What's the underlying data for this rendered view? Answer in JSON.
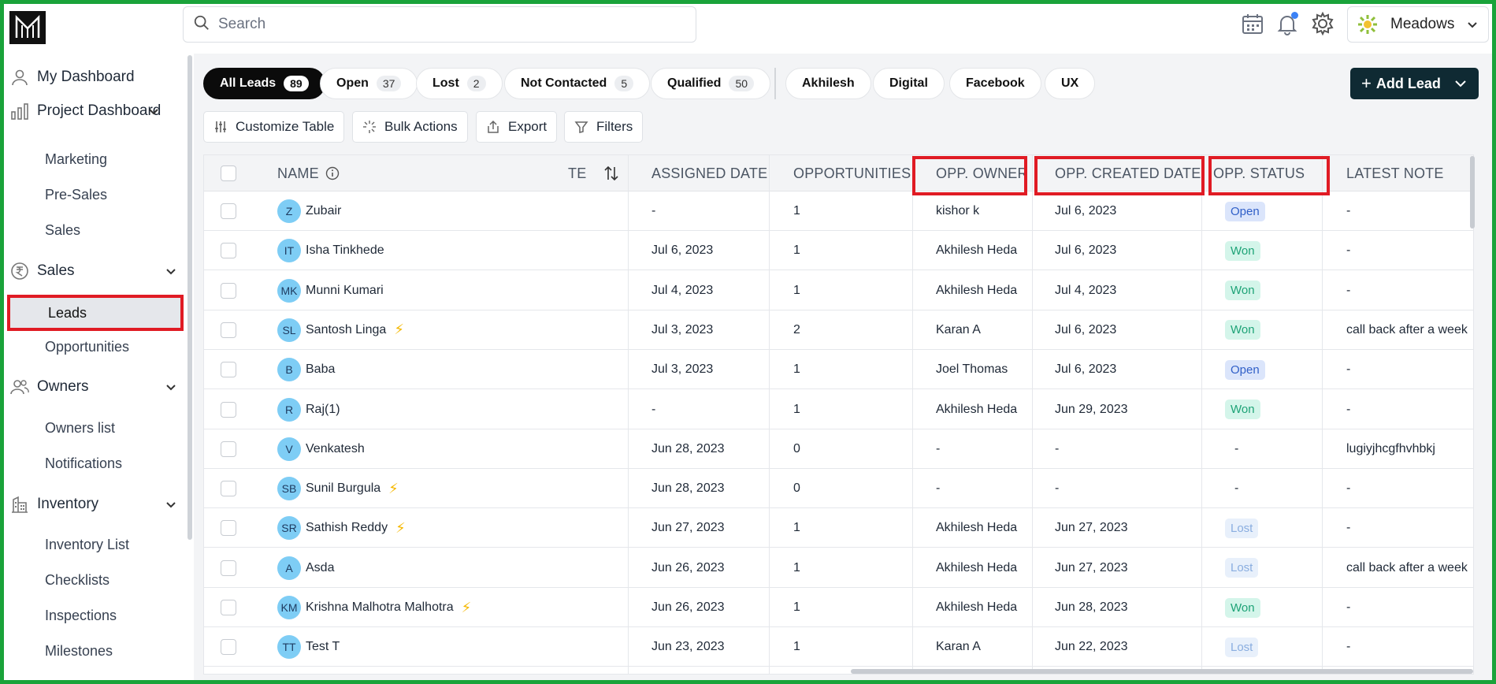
{
  "search": {
    "placeholder": "Search"
  },
  "user": {
    "name": "Meadows"
  },
  "sidebar": {
    "my_dashboard": "My Dashboard",
    "project_dashboard": "Project Dashboard",
    "project_sub": [
      "Marketing",
      "Pre-Sales",
      "Sales"
    ],
    "sales": "Sales",
    "sales_sub": [
      "Leads",
      "Opportunities"
    ],
    "owners": "Owners",
    "owners_sub": [
      "Owners list",
      "Notifications"
    ],
    "inventory": "Inventory",
    "inventory_sub": [
      "Inventory List",
      "Checklists",
      "Inspections",
      "Milestones"
    ]
  },
  "filters": [
    {
      "label": "All Leads",
      "count": "89"
    },
    {
      "label": "Open",
      "count": "37"
    },
    {
      "label": "Lost",
      "count": "2"
    },
    {
      "label": "Not Contacted",
      "count": "5"
    },
    {
      "label": "Qualified",
      "count": "50"
    }
  ],
  "tags": [
    "Akhilesh",
    "Digital",
    "Facebook",
    "UX"
  ],
  "add_lead": "Add Lead",
  "toolbar": {
    "customize": "Customize Table",
    "bulk": "Bulk Actions",
    "export": "Export",
    "filters": "Filters"
  },
  "table": {
    "headers": {
      "name": "NAME",
      "te": "TE",
      "assigned": "ASSIGNED DATE",
      "opportunities": "OPPORTUNITIES",
      "owner": "OPP. OWNER",
      "created": "OPP. CREATED DATE",
      "status": "OPP. STATUS",
      "note": "LATEST NOTE"
    },
    "rows": [
      {
        "initials": "Z",
        "name": "Zubair",
        "bolt": false,
        "assigned": "-",
        "opps": "1",
        "owner": "kishor k",
        "created": "Jul 6, 2023",
        "status": "Open",
        "note": "-"
      },
      {
        "initials": "IT",
        "name": "Isha Tinkhede",
        "bolt": false,
        "assigned": "Jul 6, 2023",
        "opps": "1",
        "owner": "Akhilesh Heda",
        "created": "Jul 6, 2023",
        "status": "Won",
        "note": "-"
      },
      {
        "initials": "MK",
        "name": "Munni Kumari",
        "bolt": false,
        "assigned": "Jul 4, 2023",
        "opps": "1",
        "owner": "Akhilesh Heda",
        "created": "Jul 4, 2023",
        "status": "Won",
        "note": "-"
      },
      {
        "initials": "SL",
        "name": "Santosh Linga",
        "bolt": true,
        "assigned": "Jul 3, 2023",
        "opps": "2",
        "owner": "Karan A",
        "created": "Jul 6, 2023",
        "status": "Won",
        "note": "call back after a week"
      },
      {
        "initials": "B",
        "name": "Baba",
        "bolt": false,
        "assigned": "Jul 3, 2023",
        "opps": "1",
        "owner": "Joel Thomas",
        "created": "Jul 6, 2023",
        "status": "Open",
        "note": "-"
      },
      {
        "initials": "R",
        "name": "Raj(1)",
        "bolt": false,
        "assigned": "-",
        "opps": "1",
        "owner": "Akhilesh Heda",
        "created": "Jun 29, 2023",
        "status": "Won",
        "note": "-"
      },
      {
        "initials": "V",
        "name": "Venkatesh",
        "bolt": false,
        "assigned": "Jun 28, 2023",
        "opps": "0",
        "owner": "-",
        "created": "-",
        "status": "-",
        "note": "lugiyjhcgfhvhbkj"
      },
      {
        "initials": "SB",
        "name": "Sunil Burgula",
        "bolt": true,
        "assigned": "Jun 28, 2023",
        "opps": "0",
        "owner": "-",
        "created": "-",
        "status": "-",
        "note": "-"
      },
      {
        "initials": "SR",
        "name": "Sathish Reddy",
        "bolt": true,
        "assigned": "Jun 27, 2023",
        "opps": "1",
        "owner": "Akhilesh Heda",
        "created": "Jun 27, 2023",
        "status": "Lost",
        "note": "-"
      },
      {
        "initials": "A",
        "name": "Asda",
        "bolt": false,
        "assigned": "Jun 26, 2023",
        "opps": "1",
        "owner": "Akhilesh Heda",
        "created": "Jun 27, 2023",
        "status": "Lost",
        "note": "call back after a week"
      },
      {
        "initials": "KM",
        "name": "Krishna Malhotra Malhotra",
        "bolt": true,
        "assigned": "Jun 26, 2023",
        "opps": "1",
        "owner": "Akhilesh Heda",
        "created": "Jun 28, 2023",
        "status": "Won",
        "note": "-"
      },
      {
        "initials": "TT",
        "name": "Test T",
        "bolt": false,
        "assigned": "Jun 23, 2023",
        "opps": "1",
        "owner": "Karan A",
        "created": "Jun 22, 2023",
        "status": "Lost",
        "note": "-"
      }
    ]
  },
  "colors": {
    "accent": "#0f2a33",
    "highlight": "#e01b24",
    "frame": "#1aa33a",
    "avatar": "#7ecdf5"
  },
  "icons": [
    "logo-icon",
    "search-icon",
    "calendar-icon",
    "bell-icon",
    "gear-icon",
    "chevron-down-icon",
    "user-icon",
    "chart-icon",
    "rupee-icon",
    "people-icon",
    "building-icon",
    "sliders-icon",
    "sparkle-icon",
    "export-icon",
    "filter-icon",
    "info-icon",
    "sort-icon",
    "bolt-icon"
  ]
}
